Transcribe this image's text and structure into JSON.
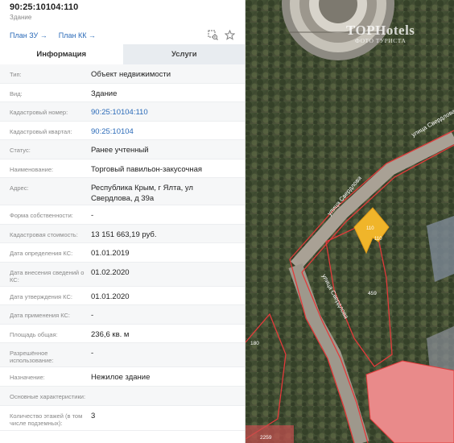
{
  "header": {
    "cadastral_number": "90:25:10104:110",
    "object_type": "Здание",
    "plan_zu": "План ЗУ →",
    "plan_kk": "План КК →"
  },
  "tabs": [
    {
      "label": "Информация",
      "active": true
    },
    {
      "label": "Услуги",
      "active": false
    }
  ],
  "rows": [
    {
      "label": "Тип:",
      "value": "Объект недвижимости"
    },
    {
      "label": "Вид:",
      "value": "Здание"
    },
    {
      "label": "Кадастровый номер:",
      "value": "90:25:10104:110",
      "link": true
    },
    {
      "label": "Кадастровый квартал:",
      "value": "90:25:10104",
      "link": true
    },
    {
      "label": "Статус:",
      "value": "Ранее учтенный"
    },
    {
      "label": "Наименование:",
      "value": "Торговый павильон-закусочная"
    },
    {
      "label": "Адрес:",
      "value": "Республика Крым, г Ялта, ул Свердлова, д 39а"
    },
    {
      "label": "Форма собственности:",
      "value": "-"
    },
    {
      "label": "Кадастровая стоимость:",
      "value": "13 151 663,19 руб."
    },
    {
      "label": "Дата определения КС:",
      "value": "01.01.2019"
    },
    {
      "label": "Дата внесения сведений о КС:",
      "value": "01.02.2020"
    },
    {
      "label": "Дата утверждения КС:",
      "value": "01.01.2020"
    },
    {
      "label": "Дата применения КС:",
      "value": "-"
    },
    {
      "label": "Площадь общая:",
      "value": "236,6 кв. м"
    },
    {
      "label": "Разрешённое использование:",
      "value": "-"
    },
    {
      "label": "Назначение:",
      "value": "Нежилое здание"
    },
    {
      "label": "Основные характеристики:",
      "value": ""
    },
    {
      "label": "Количество этажей (в том числе подземных):",
      "value": "3"
    }
  ],
  "map": {
    "street_1": "улица Свердлова",
    "street_2": "улица Свердлова",
    "street_3": "улица Свердлова",
    "parcel_459": "459",
    "parcel_180": "180",
    "parcel_2259": "2259",
    "building_labels": [
      "110",
      "110"
    ],
    "watermark_main": "TOPHotels",
    "watermark_sub": "ФОТО ТУРИСТА",
    "colors": {
      "building": "#f0b52a",
      "parcel_pink": "#e98a8a",
      "boundary": "#e23a3a",
      "road": "#b9b0a4"
    }
  }
}
